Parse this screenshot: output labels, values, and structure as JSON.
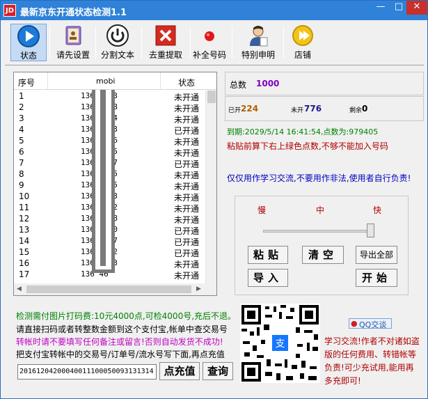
{
  "window": {
    "title": "最新京东开通状态检测1.1",
    "app_icon_text": "JD",
    "min": "—",
    "max": "□",
    "close": "✕"
  },
  "toolbar": [
    {
      "label": "状态",
      "icon": "play-icon"
    },
    {
      "label": "请先设置",
      "icon": "address-book-icon"
    },
    {
      "label": "分割文本",
      "icon": "power-icon"
    },
    {
      "label": "去重提取",
      "icon": "delete-x-icon"
    },
    {
      "label": "补全号码",
      "icon": "red-dot-icon"
    },
    {
      "label": "特别申明",
      "icon": "person-icon"
    },
    {
      "label": "店铺",
      "icon": "shop-icon"
    }
  ],
  "grid": {
    "headers": [
      "序号",
      "mobi",
      "状态"
    ],
    "rows": [
      {
        "no": "1",
        "mobi": "136    4   73",
        "status": "未开通"
      },
      {
        "no": "2",
        "mobi": "136    5   08",
        "status": "未开通"
      },
      {
        "no": "3",
        "mobi": "136    8   74",
        "status": "未开通"
      },
      {
        "no": "4",
        "mobi": "136    7   73",
        "status": "已开通"
      },
      {
        "no": "5",
        "mobi": "136    6   46",
        "status": "未开通"
      },
      {
        "no": "6",
        "mobi": "136    4   45",
        "status": "未开通"
      },
      {
        "no": "7",
        "mobi": "136    0   47",
        "status": "已开通"
      },
      {
        "no": "8",
        "mobi": "136    1   65",
        "status": "未开通"
      },
      {
        "no": "9",
        "mobi": "136    4   65",
        "status": "未开通"
      },
      {
        "no": "10",
        "mobi": "136    2   83",
        "status": "未开通"
      },
      {
        "no": "11",
        "mobi": "136    3   52",
        "status": "未开通"
      },
      {
        "no": "12",
        "mobi": "136    1   28",
        "status": "未开通"
      },
      {
        "no": "13",
        "mobi": "136    8   70",
        "status": "已开通"
      },
      {
        "no": "14",
        "mobi": "136    6   87",
        "status": "已开通"
      },
      {
        "no": "15",
        "mobi": "136    4   42",
        "status": "已开通"
      },
      {
        "no": "16",
        "mobi": "136    7   63",
        "status": "未开通"
      },
      {
        "no": "17",
        "mobi": "136        46",
        "status": "未开通"
      }
    ]
  },
  "stats": {
    "total_label": "总数",
    "total_value": "1000",
    "opened_label": "已开",
    "opened_value": "224",
    "unopened_label": "未开",
    "unopened_value": "776",
    "remaining_label": "剩余",
    "remaining_value": "0"
  },
  "expiry": "到期:2029/5/14 16:41:54,点数为:979405",
  "warning": "粘贴前算下右上绿色点数,不够不能加入号码",
  "notice": "仅仅用作学习交流,不要用作非法,使用者自行负责!",
  "speed": {
    "slow": "慢",
    "mid": "中",
    "fast": "快",
    "level": 1
  },
  "buttons": {
    "paste": "粘贴",
    "clear": "清空",
    "export": "导出全部",
    "import": "导入",
    "start": "开始"
  },
  "recharge": {
    "line1": "检测需付图片打码费:10元4000点,可检4000号,充后不退。",
    "line2": "请直接扫码或者转整数金额到这个支付宝,帐单中查交易号",
    "line3": "转帐时请不要填写任何备注或留言!否则自动发货不成功!",
    "line4": "把支付宝转帐中的交易号/订单号/流水号写下面,再点充值",
    "order_no": "20161204200040011100050093131314",
    "recharge_btn": "点充值",
    "query_btn": "查询"
  },
  "qq_label": "QQ交谈",
  "study_text": "学习交流!作者不对诸如盗版的任何费用、转错帐等负责!可少充试用,能用再多充即可!",
  "colors": {
    "title_bar": "#2f82d8",
    "accent_green": "#008000",
    "accent_red": "#b00000",
    "accent_blue": "#0000c0",
    "purple": "#8000c0"
  }
}
